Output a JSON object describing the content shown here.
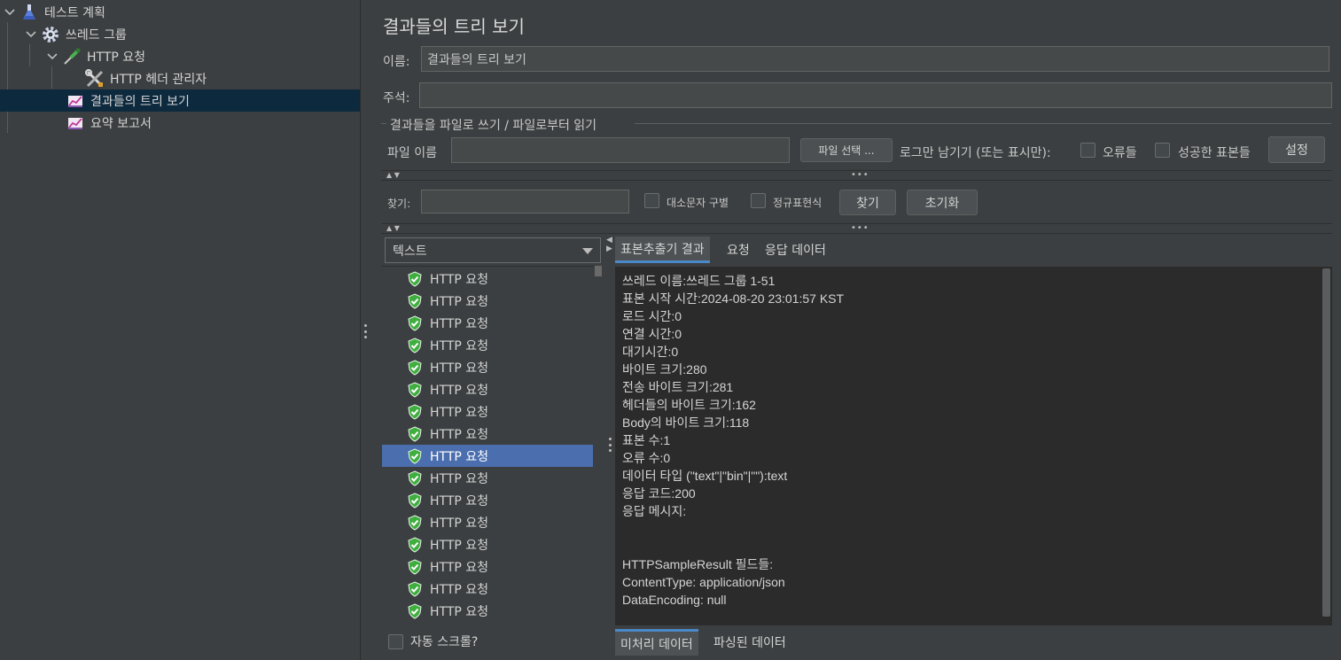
{
  "tree": {
    "items": [
      {
        "label": "테스트 계획",
        "icon": "flask-icon"
      },
      {
        "label": "쓰레드 그룹",
        "icon": "gear-icon"
      },
      {
        "label": "HTTP 요청",
        "icon": "pipette-icon"
      },
      {
        "label": "HTTP 헤더 관리자",
        "icon": "wrench-icon"
      },
      {
        "label": "결과들의 트리 보기",
        "icon": "chart-icon"
      },
      {
        "label": "요약 보고서",
        "icon": "chart-icon"
      }
    ],
    "selected_index": 4
  },
  "panel": {
    "title": "결과들의 트리 보기",
    "name_label": "이름:",
    "name_value": "결과들의 트리 보기",
    "comment_label": "주석:",
    "comment_value": "",
    "file_group_title": "결과들을 파일로 쓰기 / 파일로부터 읽기",
    "file_label": "파일 이름",
    "file_value": "",
    "browse_button": "파일 선택 ...",
    "log_only_label": "로그만 남기기 (또는 표시만):",
    "errors_label": "오류들",
    "successes_label": "성공한 표본들",
    "configure_button": "설정"
  },
  "search": {
    "label": "찾기:",
    "value": "",
    "case_sensitive_label": "대소문자 구별",
    "regex_label": "정규표현식",
    "find_button": "찾기",
    "reset_button": "초기화"
  },
  "results": {
    "renderer": "텍스트",
    "items": [
      "HTTP 요청",
      "HTTP 요청",
      "HTTP 요청",
      "HTTP 요청",
      "HTTP 요청",
      "HTTP 요청",
      "HTTP 요청",
      "HTTP 요청",
      "HTTP 요청",
      "HTTP 요청",
      "HTTP 요청",
      "HTTP 요청",
      "HTTP 요청",
      "HTTP 요청",
      "HTTP 요청",
      "HTTP 요청",
      "HTTP 요청"
    ],
    "selected_index": 8,
    "auto_scroll_label": "자동 스크롤?"
  },
  "detail": {
    "tabs": [
      "표본추출기 결과",
      "요청",
      "응답 데이터"
    ],
    "active_tab": 0,
    "lines": [
      "쓰레드 이름:쓰레드 그룹 1-51",
      "표본 시작 시간:2024-08-20 23:01:57 KST",
      "로드 시간:0",
      "연결 시간:0",
      "대기시간:0",
      "바이트 크기:280",
      "전송 바이트 크기:281",
      "헤더들의 바이트 크기:162",
      "Body의 바이트 크기:118",
      "표본 수:1",
      "오류 수:0",
      "데이터 타입 (\"text\"|\"bin\"|\"\"):text",
      "응답 코드:200",
      "응답 메시지:",
      "",
      "",
      "HTTPSampleResult 필드들:",
      "ContentType: application/json",
      "DataEncoding: null"
    ],
    "bottom_tabs": [
      "미처리 데이터",
      "파싱된 데이터"
    ],
    "active_bottom_tab": 0
  },
  "colors": {
    "background": "#3c3f41",
    "selected_tree": "#0d293e",
    "selected_list": "#4b6eaf",
    "text_area": "#2b2b2b",
    "success_shield": "#3fae3f"
  }
}
